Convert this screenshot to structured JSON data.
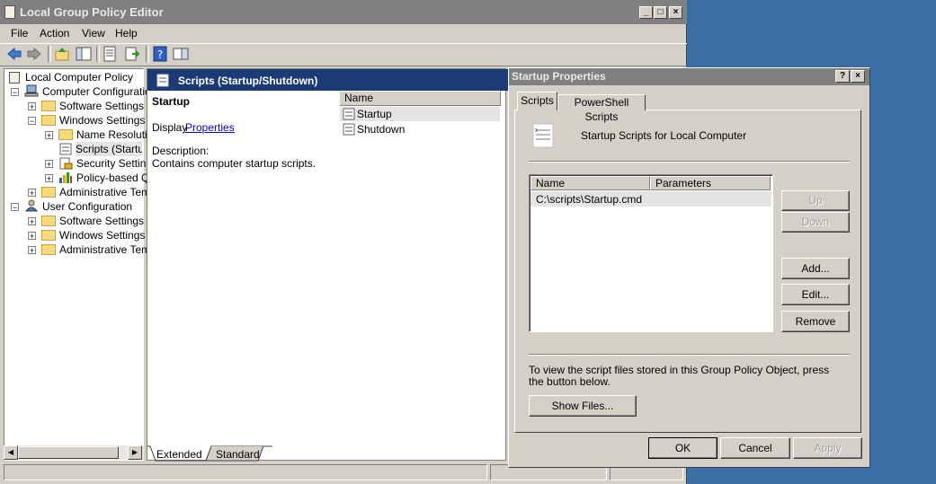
{
  "editor": {
    "title": "Local Group Policy Editor",
    "menu": [
      "File",
      "Action",
      "View",
      "Help"
    ],
    "tree": {
      "root": "Local Computer Policy",
      "computer_config": "Computer Configuratio",
      "cc_software": "Software Settings",
      "cc_windows": "Windows Settings",
      "name_resolution": "Name Resolutic",
      "scripts": "Scripts (Startup",
      "security": "Security Settin",
      "policy_qos": "Policy-based Q",
      "cc_admin": "Administrative Tem",
      "user_config": "User Configuration",
      "uc_software": "Software Settings",
      "uc_windows": "Windows Settings",
      "uc_admin": "Administrative Tem"
    },
    "detail": {
      "header": "Scripts (Startup/Shutdown)",
      "selected_name": "Startup",
      "display_prefix": "Display",
      "properties_link": "Properties",
      "description_label": "Description:",
      "description_text": "Contains computer startup scripts.",
      "list_header": "Name",
      "items": [
        "Startup",
        "Shutdown"
      ]
    },
    "bottom_tabs": [
      "Extended",
      "Standard"
    ]
  },
  "dialog": {
    "title": "Startup Properties",
    "tabs": [
      "Scripts",
      "PowerShell Scripts"
    ],
    "heading": "Startup Scripts for Local Computer",
    "columns": [
      "Name",
      "Parameters"
    ],
    "rows": [
      {
        "name": "C:\\scripts\\Startup.cmd",
        "params": ""
      }
    ],
    "buttons": {
      "up": "Up",
      "down": "Down",
      "add": "Add...",
      "edit": "Edit...",
      "remove": "Remove"
    },
    "info_text_1": "To view the script files stored in this Group Policy Object, press",
    "info_text_2": "the button below.",
    "show_files": "Show Files...",
    "ok": "OK",
    "cancel": "Cancel",
    "apply": "Apply"
  },
  "colors": {
    "desktop": "#3a6ea5",
    "header": "#1c3a73",
    "link": "#0000cc",
    "selection": "#e4e4e4"
  }
}
